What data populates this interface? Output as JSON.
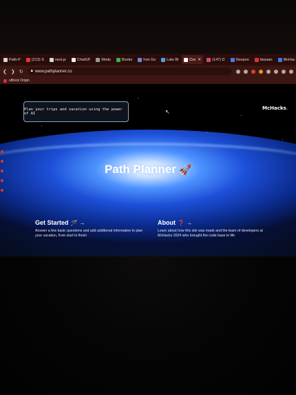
{
  "browser": {
    "tabs": [
      {
        "label": "Path-P",
        "active": false,
        "favicon": "github-icon"
      },
      {
        "label": "(213) S",
        "active": false,
        "favicon": "youtube-icon"
      },
      {
        "label": "next.js",
        "active": false,
        "favicon": "github-icon"
      },
      {
        "label": "ChatGP",
        "active": false,
        "favicon": "chatgpt-icon"
      },
      {
        "label": "Mods",
        "active": false,
        "favicon": "page-icon"
      },
      {
        "label": "Books",
        "active": false,
        "favicon": "play-icon"
      },
      {
        "label": "Iron Gs",
        "active": false,
        "favicon": "page-icon"
      },
      {
        "label": "Late Bl",
        "active": false,
        "favicon": "page-icon"
      },
      {
        "label": "Cre",
        "active": true,
        "favicon": "triangle-icon"
      },
      {
        "label": "(147) D",
        "active": false,
        "favicon": "instagram-icon"
      },
      {
        "label": "Deepon",
        "active": false,
        "favicon": "page-icon"
      },
      {
        "label": "faizaan",
        "active": false,
        "favicon": "page-icon"
      },
      {
        "label": "McHac",
        "active": false,
        "favicon": "page-icon"
      }
    ],
    "new_tab": "+",
    "url": "www.pathplanner.co",
    "bookmarks": [
      {
        "label": "uBlock Origin"
      }
    ],
    "colors": {
      "chrome": "#3b1612",
      "tabbar": "#2a0d0b"
    }
  },
  "page": {
    "tagline": "Plan your trips and vacation using the power of AI",
    "logo": {
      "text": "McHacks",
      "accent": "."
    },
    "hero_title": "Path Planner",
    "hero_emoji": "🚀",
    "cards": [
      {
        "title": "Get Started",
        "icon": "🪄",
        "arrow": "→",
        "description": "Answer a few basic questions and add additional information to plan your vacation, from start to finish"
      },
      {
        "title": "About",
        "icon": "❓",
        "arrow": "→",
        "description": "Learn about how this site was made and the team of developers at McHacks 2024 who brought the code base to life"
      }
    ]
  }
}
